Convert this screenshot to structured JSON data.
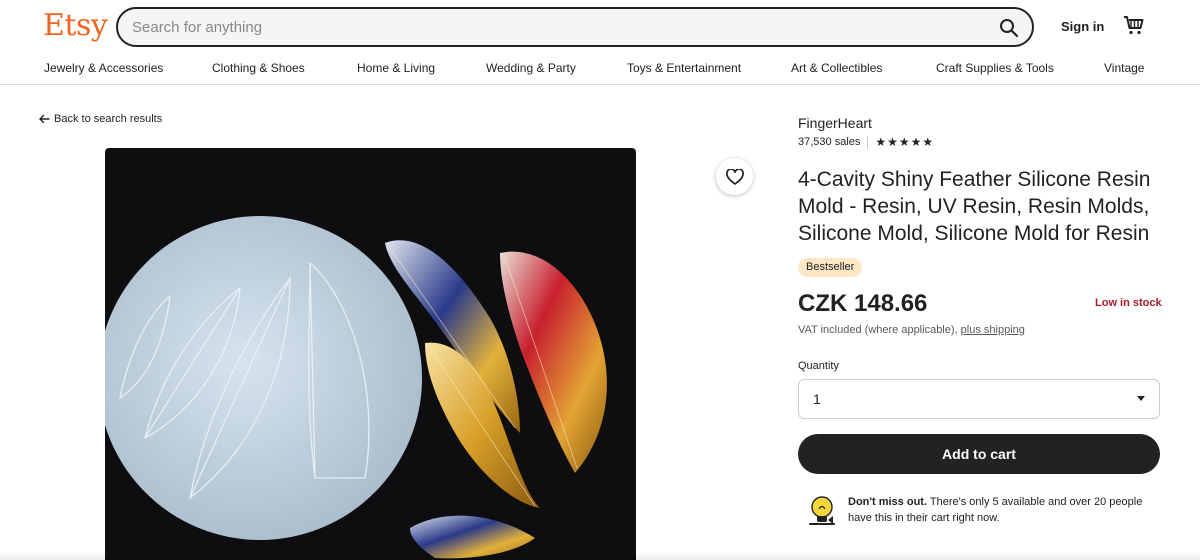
{
  "header": {
    "logo": "Etsy",
    "search_placeholder": "Search for anything",
    "sign_in": "Sign in",
    "brand_color": "#f1641e"
  },
  "categories": [
    "Jewelry & Accessories",
    "Clothing & Shoes",
    "Home & Living",
    "Wedding & Party",
    "Toys & Entertainment",
    "Art & Collectibles",
    "Craft Supplies & Tools",
    "Vintage"
  ],
  "back_link": "Back to search results",
  "product": {
    "shop_name": "FingerHeart",
    "sales": "37,530 sales",
    "rating_stars": 5,
    "title": "4-Cavity Shiny Feather Silicone Resin Mold - Resin, UV Resin, Resin Molds, Silicone Mold, Silicone Mold for Resin",
    "badge": "Bestseller",
    "price": "CZK 148.66",
    "stock": "Low in stock",
    "vat_text": "VAT included (where applicable),",
    "shipping_link": "plus shipping",
    "quantity_label": "Quantity",
    "quantity_value": "1",
    "add_to_cart": "Add to cart",
    "notice_bold": "Don't miss out.",
    "notice_text": "There's only 5 available and over 20 people have this in their cart right now."
  },
  "icons": {
    "search": "search-icon",
    "cart": "cart-icon",
    "favorite": "heart-icon",
    "back": "arrow-left-icon",
    "notice": "lightbulb-icon"
  }
}
